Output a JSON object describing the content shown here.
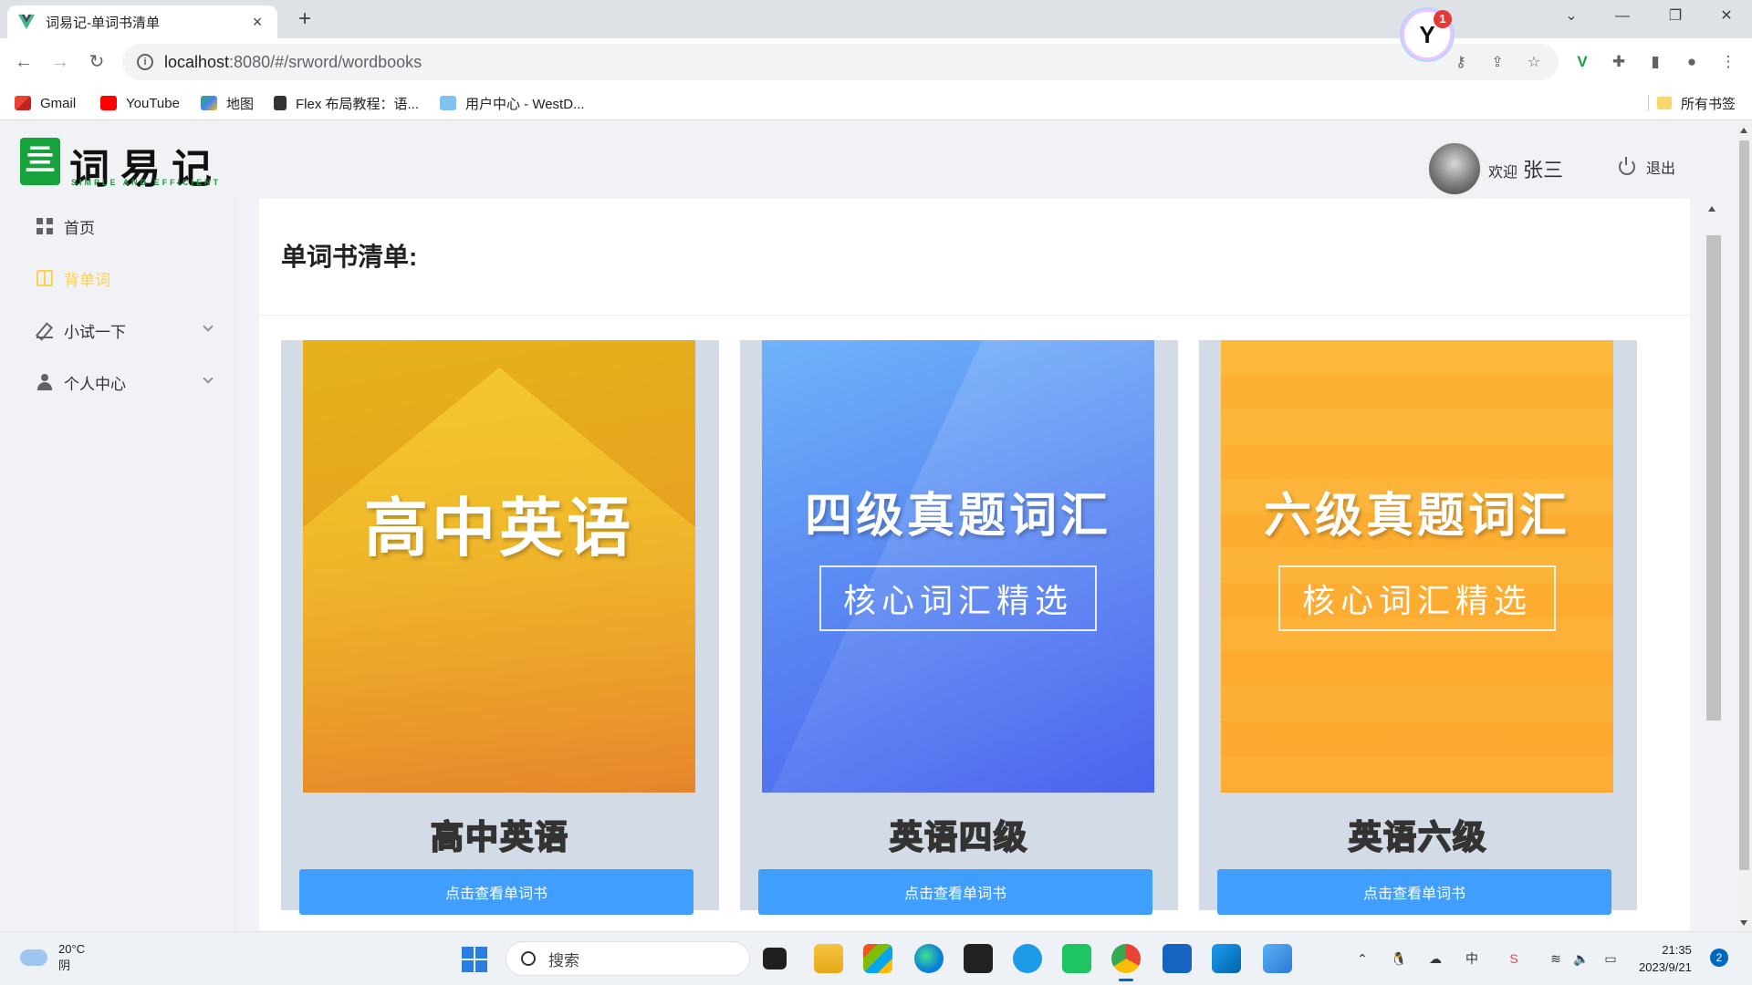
{
  "browser": {
    "tab_title": "词易记-单词书清单",
    "url_host": "localhost",
    "url_rest": ":8080/#/srword/wordbooks",
    "extension_badge": "1",
    "bookmarks": [
      "Gmail",
      "YouTube",
      "地图",
      "Flex 布局教程：语...",
      "用户中心 - WestD..."
    ],
    "all_bookmarks": "所有书签"
  },
  "app": {
    "logo_text": "词易记",
    "logo_sub": "SIMPLE AND EFFICIENT",
    "welcome": "欢迎",
    "username": "张三",
    "logout": "退出",
    "menu": [
      {
        "label": "首页",
        "icon": "grid-icon",
        "active": false
      },
      {
        "label": "背单词",
        "icon": "book-icon",
        "active": true
      },
      {
        "label": "小试一下",
        "icon": "edit-icon",
        "active": false,
        "expandable": true
      },
      {
        "label": "个人中心",
        "icon": "user-icon",
        "active": false,
        "expandable": true
      }
    ],
    "page_title": "单词书清单:",
    "books": [
      {
        "cover_title": "高中英语",
        "cover_sub": "",
        "name": "高中英语",
        "button": "点击查看单词书"
      },
      {
        "cover_title": "四级真题词汇",
        "cover_sub": "核心词汇精选",
        "name": "英语四级",
        "button": "点击查看单词书"
      },
      {
        "cover_title": "六级真题词汇",
        "cover_sub": "核心词汇精选",
        "name": "英语六级",
        "button": "点击查看单词书"
      }
    ],
    "colors": {
      "accent": "#409eff",
      "active_menu": "#ffd04b",
      "logo_green": "#17a33b"
    }
  },
  "taskbar": {
    "temperature": "20°C",
    "weather": "阴",
    "search_placeholder": "搜索",
    "time": "21:35",
    "date": "2023/9/21",
    "notifications": "2"
  }
}
